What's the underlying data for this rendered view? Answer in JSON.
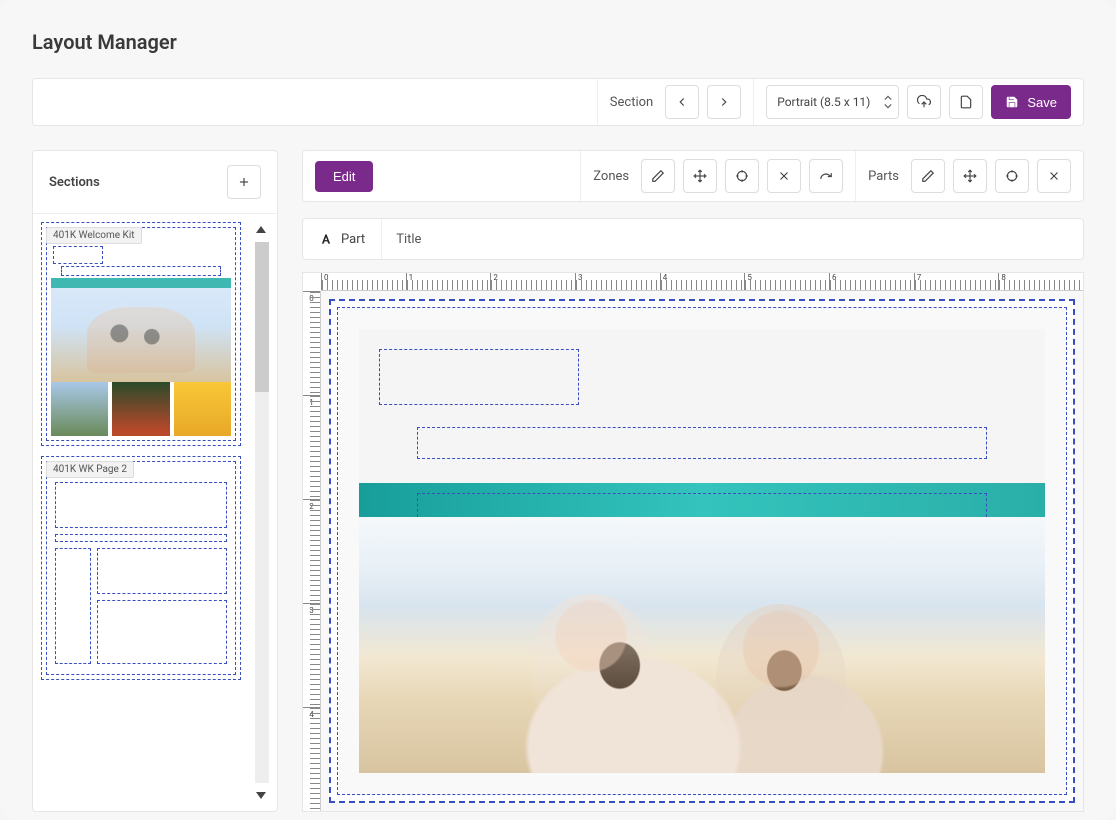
{
  "page_title": "Layout Manager",
  "toolbar": {
    "section_label": "Section",
    "page_size": "Portrait (8.5 x 11)",
    "save_label": "Save"
  },
  "sections_panel": {
    "title": "Sections",
    "items": [
      {
        "label": "401K Welcome Kit"
      },
      {
        "label": "401K WK Page 2"
      }
    ]
  },
  "editor_toolbar": {
    "edit_label": "Edit",
    "zones_label": "Zones",
    "parts_label": "Parts"
  },
  "part_bar": {
    "part_label": "Part",
    "title_placeholder": "Title"
  },
  "ruler_h": [
    "0",
    "1",
    "2",
    "3",
    "4",
    "5",
    "6",
    "7",
    "8"
  ],
  "ruler_v": [
    "0",
    "1",
    "2",
    "3",
    "4"
  ]
}
